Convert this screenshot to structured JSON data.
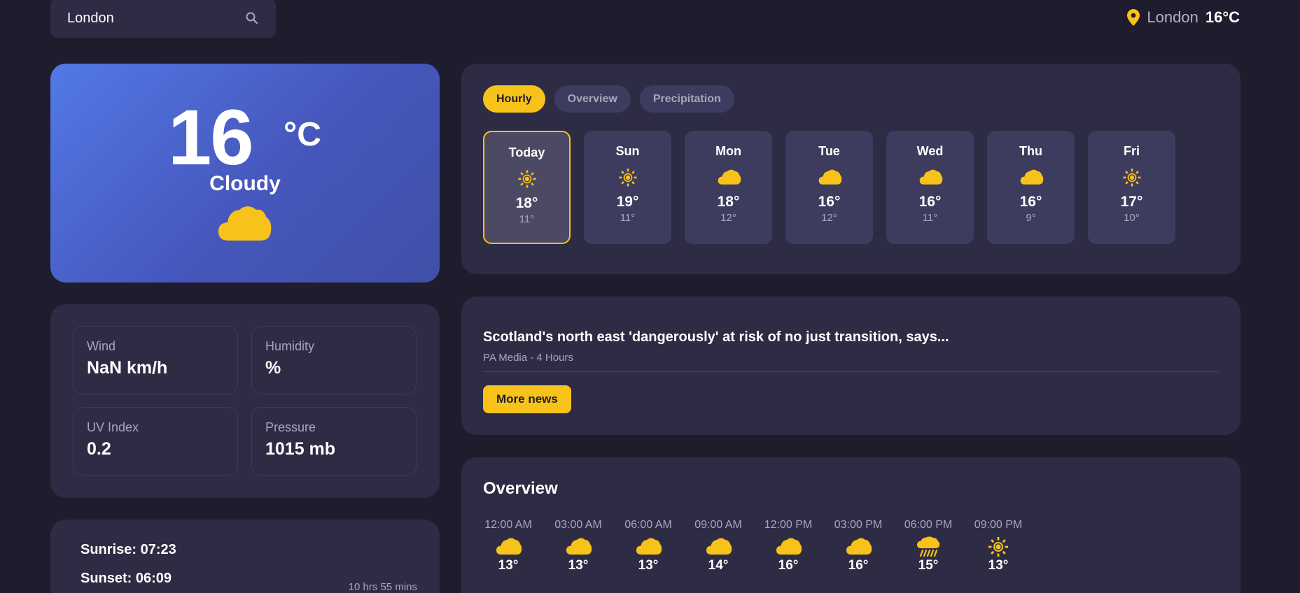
{
  "search": {
    "value": "London",
    "icon": "search-icon"
  },
  "top": {
    "city": "London",
    "temp": "16°C",
    "icon": "location-pin-icon"
  },
  "current": {
    "temp": "16",
    "unit": "°C",
    "condition": "Cloudy",
    "icon": "cloud-icon"
  },
  "stats": [
    {
      "label": "Wind",
      "value": "NaN km/h"
    },
    {
      "label": "Humidity",
      "value": "%"
    },
    {
      "label": "UV Index",
      "value": "0.2"
    },
    {
      "label": "Pressure",
      "value": "1015 mb"
    }
  ],
  "sun": {
    "sunrise": "Sunrise: 07:23",
    "sunset": "Sunset: 06:09",
    "daylight": "10 hrs 55 mins"
  },
  "tabs": [
    {
      "label": "Hourly",
      "active": true
    },
    {
      "label": "Overview",
      "active": false
    },
    {
      "label": "Precipitation",
      "active": false
    }
  ],
  "days": [
    {
      "name": "Today",
      "icon": "sun",
      "hi": "18°",
      "lo": "11°",
      "active": true
    },
    {
      "name": "Sun",
      "icon": "sun",
      "hi": "19°",
      "lo": "11°"
    },
    {
      "name": "Mon",
      "icon": "cloud",
      "hi": "18°",
      "lo": "12°"
    },
    {
      "name": "Tue",
      "icon": "cloud",
      "hi": "16°",
      "lo": "12°"
    },
    {
      "name": "Wed",
      "icon": "cloud",
      "hi": "16°",
      "lo": "11°"
    },
    {
      "name": "Thu",
      "icon": "cloud",
      "hi": "16°",
      "lo": "9°"
    },
    {
      "name": "Fri",
      "icon": "sun",
      "hi": "17°",
      "lo": "10°"
    }
  ],
  "news": {
    "headline": "Scotland's north east 'dangerously' at risk of no just transition, says...",
    "source": "PA Media - 4 Hours",
    "button": "More news"
  },
  "overview": {
    "title": "Overview",
    "hours": [
      {
        "time": "12:00 AM",
        "icon": "cloud",
        "temp": "13°"
      },
      {
        "time": "03:00 AM",
        "icon": "cloud",
        "temp": "13°"
      },
      {
        "time": "06:00 AM",
        "icon": "cloud",
        "temp": "13°"
      },
      {
        "time": "09:00 AM",
        "icon": "cloud",
        "temp": "14°"
      },
      {
        "time": "12:00 PM",
        "icon": "cloud",
        "temp": "16°"
      },
      {
        "time": "03:00 PM",
        "icon": "cloud",
        "temp": "16°"
      },
      {
        "time": "06:00 PM",
        "icon": "rain",
        "temp": "15°"
      },
      {
        "time": "09:00 PM",
        "icon": "sun",
        "temp": "13°"
      }
    ]
  },
  "colors": {
    "accent": "#f7c31a",
    "background": "#1e1c2d",
    "card": "#2e2c44"
  }
}
